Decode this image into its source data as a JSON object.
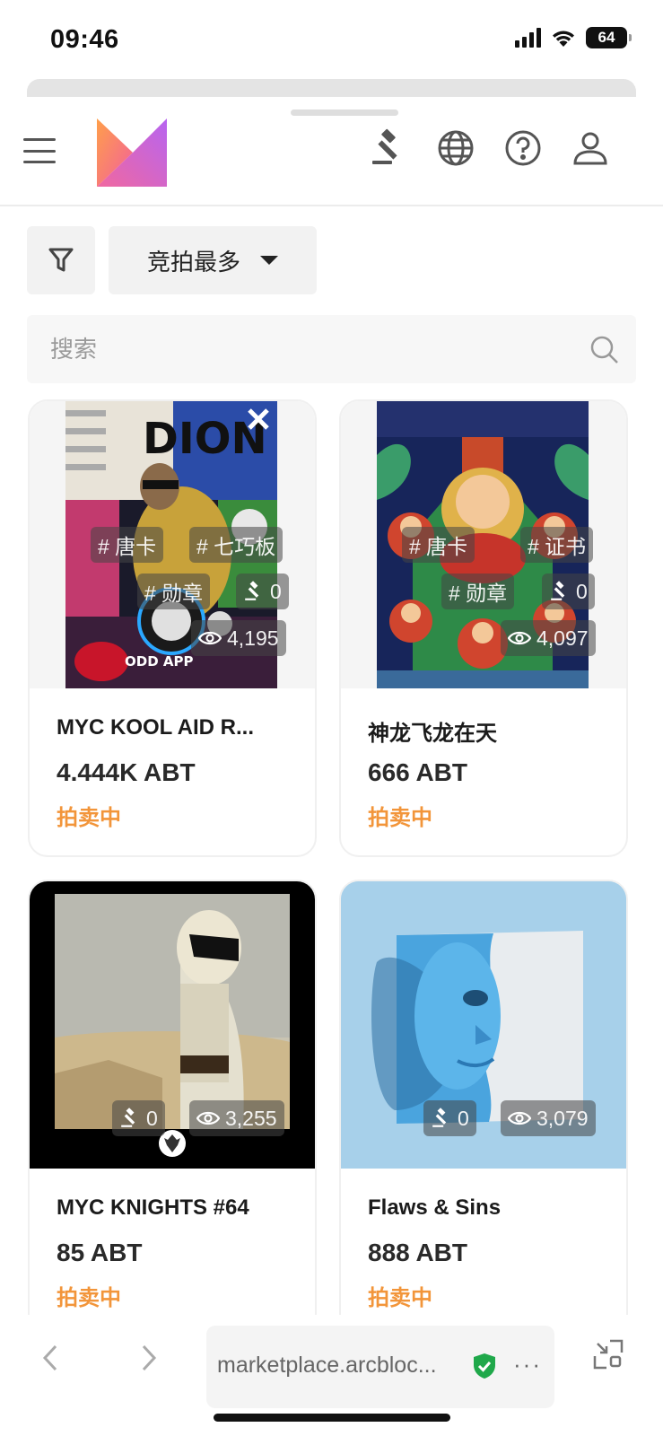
{
  "status_bar": {
    "time": "09:46",
    "battery": "64"
  },
  "header": {
    "icons": [
      "auction-gavel-icon",
      "globe-icon",
      "help-icon",
      "user-icon"
    ]
  },
  "toolbar": {
    "sort_label": "竞拍最多"
  },
  "search": {
    "placeholder": "搜索"
  },
  "cards": [
    {
      "title": "MYC KOOL AID R...",
      "price": "4.444K ABT",
      "status": "拍卖中",
      "tags": [
        "# 唐卡",
        "# 七巧板",
        "# 勋章"
      ],
      "bids": "0",
      "views": "4,195",
      "art_text": "DION",
      "art_caption": "ODD APP"
    },
    {
      "title": "神龙飞龙在天",
      "price": "666 ABT",
      "status": "拍卖中",
      "tags": [
        "# 唐卡",
        "# 证书",
        "# 勋章"
      ],
      "bids": "0",
      "views": "4,097"
    },
    {
      "title": "MYC KNIGHTS #64",
      "price": "85 ABT",
      "status": "拍卖中",
      "bids": "0",
      "views": "3,255"
    },
    {
      "title": "Flaws & Sins",
      "price": "888 ABT",
      "status": "拍卖中",
      "bids": "0",
      "views": "3,079"
    }
  ],
  "browser": {
    "url": "marketplace.arcbloc...",
    "more": "···"
  },
  "colors": {
    "accent": "#f2953a",
    "tag_bg": "#464646"
  }
}
